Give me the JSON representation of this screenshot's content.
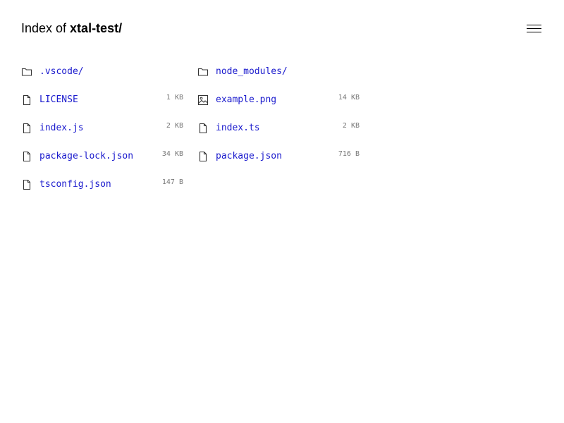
{
  "header": {
    "prefix": "Index of ",
    "path": "xtal-test/"
  },
  "menu": {
    "icon": "hamburger-menu-icon"
  },
  "colors": {
    "link": "#1a1acd",
    "size": "#777777",
    "text": "#000000",
    "icon": "#333333"
  },
  "entries": [
    {
      "name": ".vscode/",
      "size": "",
      "icon": "folder-icon"
    },
    {
      "name": "node_modules/",
      "size": "",
      "icon": "folder-icon"
    },
    {
      "name": "LICENSE",
      "size": "1 KB",
      "icon": "file-icon"
    },
    {
      "name": "example.png",
      "size": "14 KB",
      "icon": "image-icon"
    },
    {
      "name": "index.js",
      "size": "2 KB",
      "icon": "file-icon"
    },
    {
      "name": "index.ts",
      "size": "2 KB",
      "icon": "file-icon"
    },
    {
      "name": "package-lock.json",
      "size": "34 KB",
      "icon": "file-icon"
    },
    {
      "name": "package.json",
      "size": "716 B",
      "icon": "file-icon"
    },
    {
      "name": "tsconfig.json",
      "size": "147 B",
      "icon": "file-icon"
    }
  ]
}
